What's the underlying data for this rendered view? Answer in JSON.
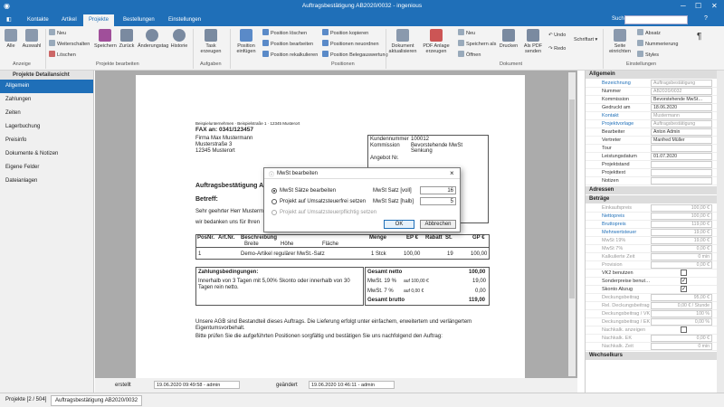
{
  "window": {
    "title": "Auftragsbestätigung AB2020/0032 - ingenious"
  },
  "menu": {
    "tabs": [
      "Kontakte",
      "Artikel",
      "Projekte",
      "Bestellungen",
      "Einstellungen"
    ],
    "active": "Projekte",
    "search_label": "Suche:"
  },
  "ribbon": {
    "anzeige": [
      "Alle",
      "Auswahl"
    ],
    "projekte": {
      "small": [
        "Neu",
        "Weiterschalten",
        "Löschen"
      ],
      "large": [
        "Speichern",
        "Zurück",
        "Änderungstag",
        "Historie"
      ]
    },
    "aufgaben": [
      "Task erzeugen"
    ],
    "positionen": {
      "large": [
        "Position einfügen"
      ],
      "small": [
        "Position löschen",
        "Position bearbeiten",
        "Position rekalkulieren",
        "Position kopieren",
        "Positionen neuordnen",
        "Position Belegauswertung"
      ]
    },
    "dokument": {
      "large": [
        "Dokument aktualisieren",
        "PDF Anlage erzeugen"
      ],
      "small": [
        "Neu",
        "Speichern als",
        "Öffnen"
      ],
      "large2": [
        "Drucken",
        "Als PDF senden"
      ],
      "undo": [
        "Undo",
        "Redo"
      ],
      "font": "Schriftart"
    },
    "einstellungen": [
      "Seite einrichten",
      "Absatz",
      "Nummerierung",
      "Styles"
    ],
    "groups": [
      "Anzeige",
      "Projekte bearbeiten",
      "Aufgaben",
      "Positionen",
      "Dokument",
      "Einstellungen"
    ]
  },
  "left": {
    "header": "Projekte Detailansicht",
    "items": [
      "Allgemein",
      "Zahlungen",
      "Zeiten",
      "Lagerbuchung",
      "Preisinfo",
      "Dokumente & Notizen",
      "Eigene Felder",
      "Dateianlagen"
    ],
    "selected": "Allgemein"
  },
  "doc": {
    "sender": "Beispielunternehmen · Beispielstraße 1 · 12345 Musterort",
    "fax": "FAX an: 0341/123457",
    "address": [
      "Firma Max Mustermann",
      "Musterstraße 3",
      "12345 Musterort"
    ],
    "info": [
      [
        "Kundennummer",
        "100012"
      ],
      [
        "Kommission",
        "Bevorstehende MwSt Senkung"
      ],
      [
        "Angebot Nr.",
        ""
      ]
    ],
    "title": "Auftragsbestätigung AB",
    "betreff": "Betreff:",
    "greeting": "Sehr geehrter Herr Musterm",
    "intro": "wir bedanken uns für Ihren",
    "table": {
      "headers": [
        "PosNr.",
        "Art.Nr.",
        "Beschreibung",
        "Menge",
        "EP €",
        "Rabatt",
        "St.",
        "GP €"
      ],
      "subheaders": [
        "Breite",
        "Höhe",
        "Fläche"
      ],
      "row": [
        "1",
        "",
        "Demo-Artikel regulärer MwSt.-Satz",
        "1 Stck",
        "100,00",
        "",
        "19",
        "100,00"
      ]
    },
    "zahlung_title": "Zahlungsbedingungen:",
    "zahlung_text": "Innerhalb von 3 Tagen mit 5,00% Skonto oder innerhalb von 30 Tagen rein netto.",
    "totals": [
      [
        "Gesamt netto",
        "",
        "100,00"
      ],
      [
        "MwSt. 19 %",
        "auf 100,00 €",
        "19,00"
      ],
      [
        "MwSt. 7 %",
        "auf 0,00 €",
        "0,00"
      ],
      [
        "Gesamt brutto",
        "",
        "119,00"
      ]
    ],
    "footer1": "Unsere AGB sind Bestandteil dieses Auftrags. Die Lieferung erfolgt unter einfachem, erweitertem und verlängertem Eigentumsvorbehalt.",
    "footer2": "Bitte prüfen Sie die aufgeführten Positionen sorgfältig und bestätigen Sie uns nachfolgend den Auftrag:"
  },
  "dialog": {
    "title": "MwSt bearbeiten",
    "options": [
      "MwSt Sätze bearbeiten",
      "Projekt auf Umsatzsteuerfrei setzen",
      "Projekt auf Umsatzsteuerpflichtig setzen"
    ],
    "voll_label": "MwSt Satz [voll]",
    "voll_value": "16",
    "halb_label": "MwSt Satz [halb]",
    "halb_value": "5",
    "ok": "OK",
    "cancel": "Abbrechen"
  },
  "status": {
    "created_label": "erstellt",
    "created_value": "19.06.2020 09:49:58 - admin",
    "changed_label": "geändert",
    "changed_value": "19.06.2020 10:46:11 - admin"
  },
  "bottom_tabs": [
    "Projekte [2 / 504]",
    "Auftragsbestätigung AB2020/0032"
  ],
  "right": {
    "sections": [
      "Allgemein",
      "Adressen",
      "Beträge",
      "Wechselkurs"
    ],
    "allgemein": [
      [
        "Bezeichnung",
        "Auftragsbestätigung",
        "link",
        "gray"
      ],
      [
        "Nummer",
        "AB2020/0032",
        "",
        "gray"
      ],
      [
        "Kommission",
        "Bevorstehende MwSt…",
        "",
        ""
      ],
      [
        "Gedruckt am",
        "18.06.2020",
        "",
        ""
      ],
      [
        "Kontakt",
        "Mustermann",
        "link",
        "gray"
      ],
      [
        "Projektvorlage",
        "Auftragsbestätigung",
        "link",
        "gray"
      ],
      [
        "Bearbeiter",
        "Anton Admin",
        "",
        ""
      ],
      [
        "Vertreter",
        "Manfred Müller",
        "",
        ""
      ],
      [
        "Tour",
        "",
        "",
        ""
      ],
      [
        "Leistungsdatum",
        "01.07.2020",
        "",
        ""
      ],
      [
        "Projektstand",
        "",
        "",
        ""
      ],
      [
        "Projekttext",
        "",
        "",
        ""
      ],
      [
        "Notizen",
        "",
        "",
        ""
      ]
    ],
    "betraege": [
      [
        "Einkaufspreis",
        "100,00 €",
        "gray",
        "gray"
      ],
      [
        "Nettopreis",
        "100,00 €",
        "link",
        "gray"
      ],
      [
        "Bruttopreis",
        "119,00 €",
        "link",
        "gray"
      ],
      [
        "Mehrwertsteuer",
        "19,00 €",
        "link",
        "gray"
      ],
      [
        "MwSt 19%",
        "19,00 €",
        "gray",
        "gray"
      ],
      [
        "MwSt 7%",
        "0,00 €",
        "gray",
        "gray"
      ],
      [
        "Kalkulierte Zeit",
        "0 min",
        "gray",
        "gray"
      ],
      [
        "Provision",
        "0,00 €",
        "gray",
        "gray"
      ],
      [
        "VK2 benutzen",
        "cb0",
        "",
        ""
      ],
      [
        "Sonderpreise benut…",
        "cb1",
        "",
        ""
      ],
      [
        "Skonto Abzug",
        "cb1",
        "",
        ""
      ],
      [
        "Deckungsbeitrag",
        "95,00 €",
        "gray",
        "gray"
      ],
      [
        "Rel. Deckungsbeitrag",
        "0,00 € / Stunde",
        "gray",
        "gray"
      ],
      [
        "Deckungsbeitrag / VK",
        "100 %",
        "gray",
        "gray"
      ],
      [
        "Deckungsbeitrag / EK",
        "0,00 %",
        "gray",
        "gray"
      ],
      [
        "Nachkalk. anzeigen",
        "cb0",
        "gray",
        ""
      ],
      [
        "Nachkalk. EK",
        "0,00 €",
        "gray",
        "gray"
      ],
      [
        "Nachkalk. Zeit",
        "0 min",
        "gray",
        "gray"
      ]
    ]
  }
}
